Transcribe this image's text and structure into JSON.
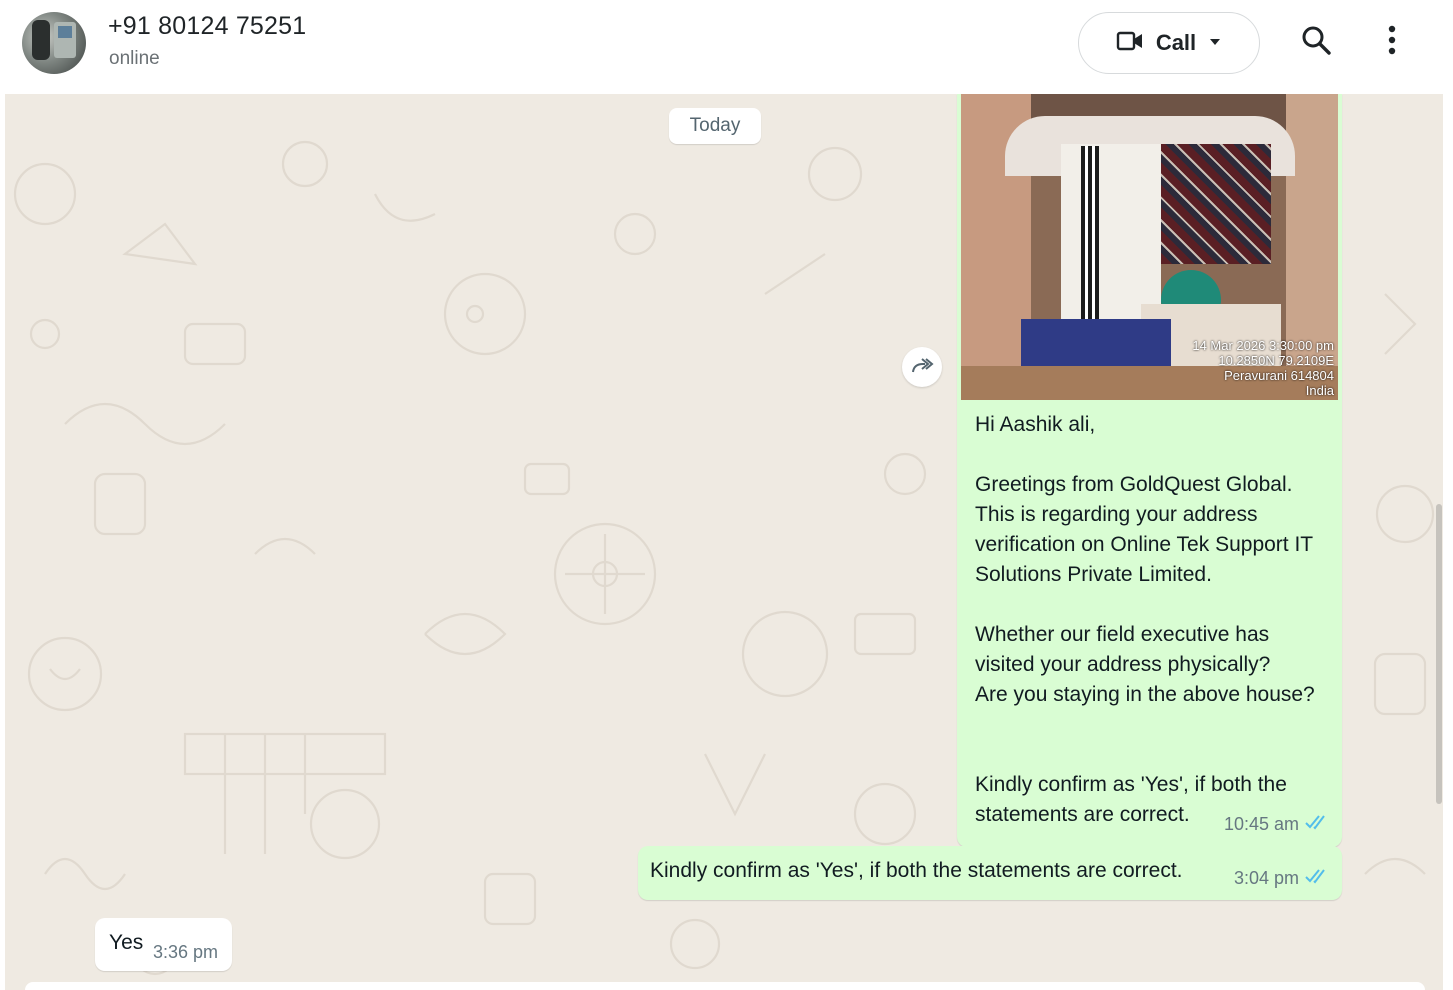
{
  "header": {
    "contact_name": "+91 80124 75251",
    "status": "online",
    "call_label": "Call",
    "icons": [
      "video-camera-icon",
      "caret-down-icon",
      "search-icon",
      "more-vertical-icon"
    ]
  },
  "chat": {
    "date_separator": "Today",
    "messages": [
      {
        "direction": "outgoing",
        "has_image": true,
        "image_stamp": [
          "14 Mar 2026 3:30:00 pm",
          "10.2850N 79.2109E",
          "Peravurani 614804",
          "India"
        ],
        "greeting": "Hi Aashik ali,",
        "para1": "Greetings from GoldQuest Global.\nThis is regarding your address\nverification on Online Tek Support IT\nSolutions Private Limited.",
        "para2": "Whether our field executive has\nvisited your address physically?\nAre you staying in the above house?",
        "para3": "Kindly confirm as 'Yes', if both the\nstatements are correct.",
        "time": "10:45 am",
        "status": "read"
      },
      {
        "direction": "outgoing",
        "text": "Kindly confirm as 'Yes', if both the statements are correct.",
        "time": "3:04 pm",
        "status": "read"
      },
      {
        "direction": "incoming",
        "text": "Yes",
        "time": "3:36 pm"
      }
    ]
  },
  "colors": {
    "outgoing_bubble": "#d9fdd3",
    "incoming_bubble": "#ffffff",
    "chat_background": "#efeae2",
    "read_tick": "#53bdeb"
  }
}
